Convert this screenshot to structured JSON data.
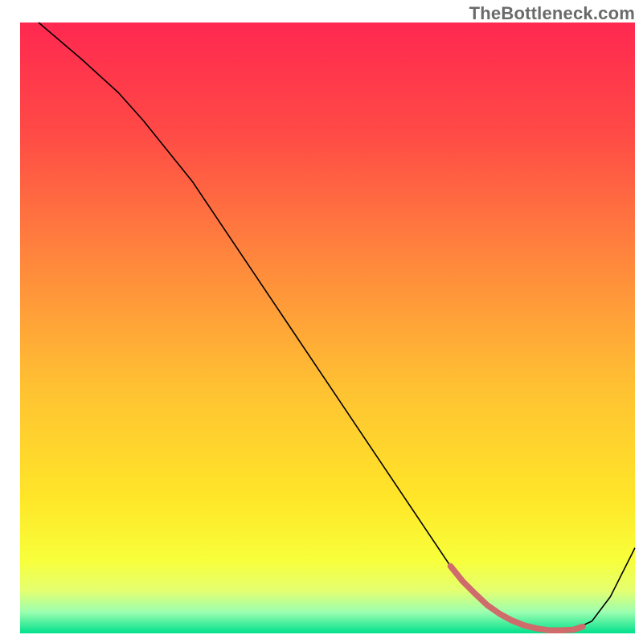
{
  "watermark": "TheBottleneck.com",
  "chart_data": {
    "type": "line",
    "title": "",
    "xlabel": "",
    "ylabel": "",
    "xlim": [
      0,
      100
    ],
    "ylim": [
      0,
      100
    ],
    "grid": false,
    "legend": false,
    "background_gradient": {
      "stops": [
        {
          "offset": 0.0,
          "color": "#ff2850"
        },
        {
          "offset": 0.18,
          "color": "#ff4a46"
        },
        {
          "offset": 0.4,
          "color": "#ff8a3c"
        },
        {
          "offset": 0.6,
          "color": "#ffc232"
        },
        {
          "offset": 0.78,
          "color": "#ffe628"
        },
        {
          "offset": 0.88,
          "color": "#f8ff3a"
        },
        {
          "offset": 0.93,
          "color": "#e4ff70"
        },
        {
          "offset": 0.965,
          "color": "#9cffb0"
        },
        {
          "offset": 1.0,
          "color": "#00e08c"
        }
      ]
    },
    "series": [
      {
        "name": "curve",
        "color": "#000000",
        "width": 1.6,
        "x": [
          3,
          10,
          16,
          20,
          28,
          36,
          44,
          52,
          60,
          66,
          70,
          74,
          78,
          82,
          86,
          90,
          93,
          96,
          100
        ],
        "y": [
          100,
          94,
          88.5,
          84,
          74,
          62,
          50,
          38,
          26,
          17,
          11,
          6.5,
          3.2,
          1.3,
          0.5,
          0.6,
          2.0,
          6.0,
          14.0
        ]
      },
      {
        "name": "highlight",
        "color": "#cf6b6b",
        "width": 7.5,
        "linecap": "round",
        "x": [
          70,
          72,
          74,
          76,
          78,
          80,
          82,
          84,
          86,
          88,
          90,
          91.5
        ],
        "y": [
          11,
          8.5,
          6.5,
          4.6,
          3.2,
          2.1,
          1.3,
          0.8,
          0.5,
          0.5,
          0.6,
          1.1
        ]
      }
    ],
    "annotations": []
  }
}
